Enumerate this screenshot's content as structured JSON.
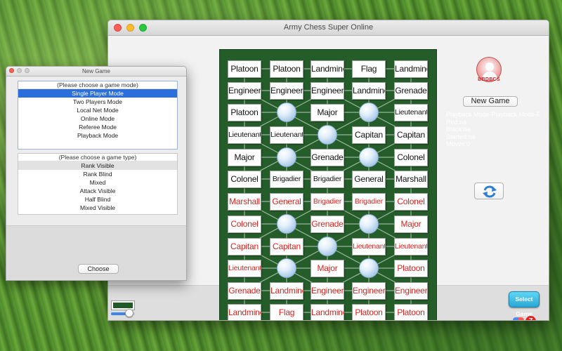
{
  "main_window": {
    "title": "Army Chess Super Online"
  },
  "board": {
    "rows": [
      [
        {
          "t": "Platoon",
          "c": "black"
        },
        {
          "t": "Platoon",
          "c": "black"
        },
        {
          "t": "Landmine",
          "c": "black"
        },
        {
          "t": "Flag",
          "c": "black"
        },
        {
          "t": "Landmine",
          "c": "black"
        }
      ],
      [
        {
          "t": "Engineer",
          "c": "black"
        },
        {
          "t": "Engineer",
          "c": "black"
        },
        {
          "t": "Engineer",
          "c": "black"
        },
        {
          "t": "Landmine",
          "c": "black"
        },
        {
          "t": "Grenade",
          "c": "black"
        }
      ],
      [
        {
          "t": "Platoon",
          "c": "black"
        },
        null,
        {
          "t": "Major",
          "c": "black"
        },
        null,
        {
          "t": "Lieutenant",
          "c": "black"
        }
      ],
      [
        {
          "t": "Lieutenant",
          "c": "black"
        },
        {
          "t": "Lieutenant",
          "c": "black"
        },
        null,
        {
          "t": "Capitan",
          "c": "black"
        },
        {
          "t": "Capitan",
          "c": "black"
        }
      ],
      [
        {
          "t": "Major",
          "c": "black"
        },
        null,
        {
          "t": "Grenade",
          "c": "black"
        },
        null,
        {
          "t": "Colonel",
          "c": "black"
        }
      ],
      [
        {
          "t": "Colonel",
          "c": "black"
        },
        {
          "t": "Brigadier",
          "c": "black"
        },
        {
          "t": "Brigadier",
          "c": "black"
        },
        {
          "t": "General",
          "c": "black"
        },
        {
          "t": "Marshall",
          "c": "black"
        }
      ],
      [
        {
          "t": "Marshall",
          "c": "red"
        },
        {
          "t": "General",
          "c": "red"
        },
        {
          "t": "Brigadier",
          "c": "red"
        },
        {
          "t": "Brigadier",
          "c": "red"
        },
        {
          "t": "Colonel",
          "c": "red"
        }
      ],
      [
        {
          "t": "Colonel",
          "c": "red"
        },
        null,
        {
          "t": "Grenade",
          "c": "red"
        },
        null,
        {
          "t": "Major",
          "c": "red"
        }
      ],
      [
        {
          "t": "Capitan",
          "c": "red"
        },
        {
          "t": "Capitan",
          "c": "red"
        },
        null,
        {
          "t": "Lieutenant",
          "c": "red"
        },
        {
          "t": "Lieutenant",
          "c": "red"
        }
      ],
      [
        {
          "t": "Lieutenant",
          "c": "red"
        },
        null,
        {
          "t": "Major",
          "c": "red"
        },
        null,
        {
          "t": "Platoon",
          "c": "red"
        }
      ],
      [
        {
          "t": "Grenade",
          "c": "red"
        },
        {
          "t": "Landmine",
          "c": "red"
        },
        {
          "t": "Engineer",
          "c": "red"
        },
        {
          "t": "Engineer",
          "c": "red"
        },
        {
          "t": "Engineer",
          "c": "red"
        }
      ],
      [
        {
          "t": "Landmine",
          "c": "red"
        },
        {
          "t": "Flag",
          "c": "red"
        },
        {
          "t": "Landmine",
          "c": "red"
        },
        {
          "t": "Platoon",
          "c": "red"
        },
        {
          "t": "Platoon",
          "c": "red"
        }
      ]
    ],
    "camps": [
      [
        2,
        1
      ],
      [
        2,
        3
      ],
      [
        3,
        2
      ],
      [
        4,
        1
      ],
      [
        4,
        3
      ],
      [
        7,
        1
      ],
      [
        7,
        3
      ],
      [
        8,
        2
      ],
      [
        9,
        1
      ],
      [
        9,
        3
      ]
    ]
  },
  "colors": {
    "board_green": "#245d2a",
    "red_piece": "#d8231e",
    "black_piece": "#111111",
    "selection_blue": "#2a6fdb"
  },
  "right_panel": {
    "avatar_icon": "user-avatar-icon",
    "avatar_label": "BBDBCS",
    "new_game_label": "New Game",
    "info_lines": [
      "Playback Mode-Playback Mode-F",
      "Red:na",
      "Black:na",
      "Started:na",
      "Moves:0"
    ],
    "swap_icon": "swap-arrows-icon",
    "select_game_label": "Select Game",
    "z_label": "Z"
  },
  "slider": {
    "value_fraction": 0.75
  },
  "dialog": {
    "title": "New Game",
    "mode_header": "(Please choose a game mode)",
    "modes": [
      "Single Player Mode",
      "Two Players Mode",
      "Local Net Mode",
      "Online Mode",
      "Referee Mode",
      "Playback Mode"
    ],
    "selected_mode": 0,
    "type_header": "(Please choose a game type)",
    "types": [
      "Rank Visible",
      "Rank Blind",
      "Mixed",
      "Attack Visible",
      "Half Blind",
      "Mixed Visible"
    ],
    "highlighted_type": 0,
    "choose_label": "Choose"
  }
}
